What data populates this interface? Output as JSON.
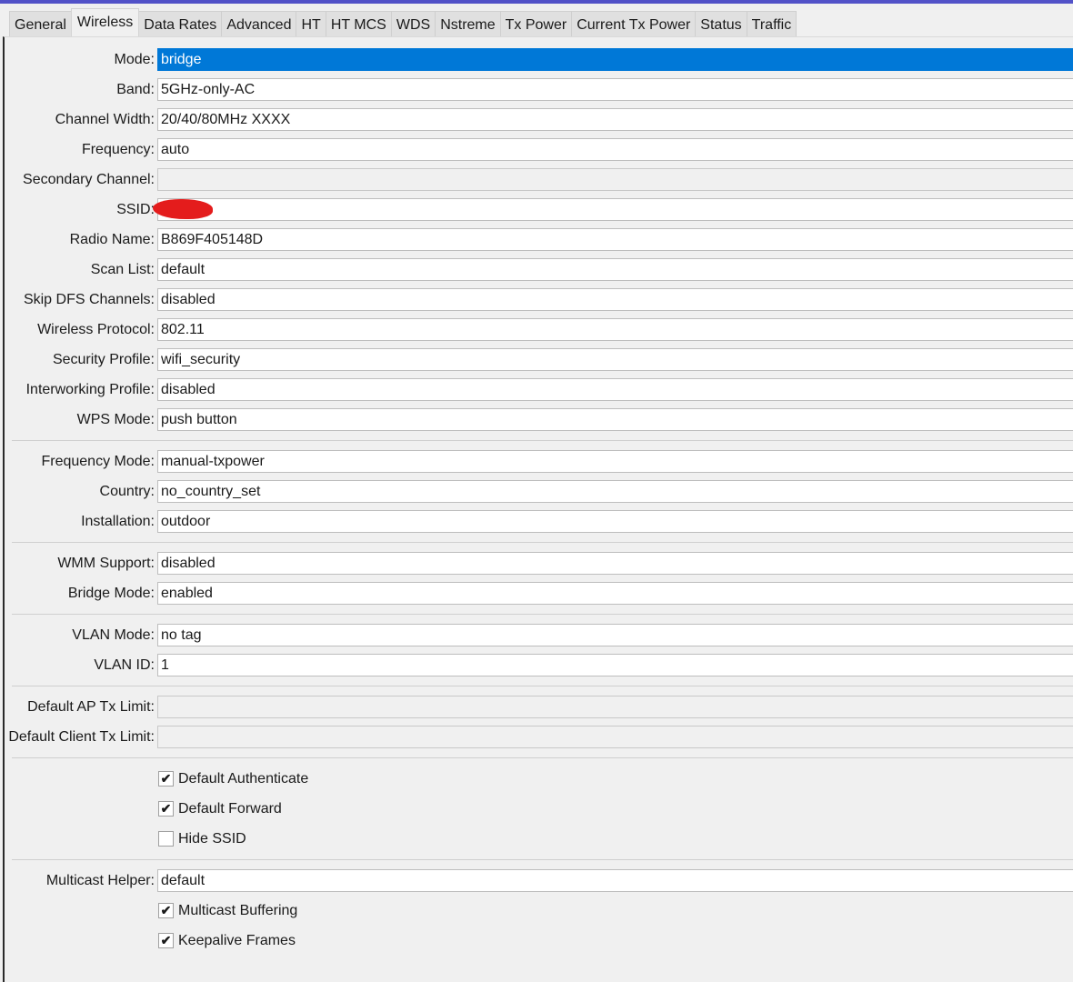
{
  "tabs": [
    "General",
    "Wireless",
    "Data Rates",
    "Advanced",
    "HT",
    "HT MCS",
    "WDS",
    "Nstreme",
    "Tx Power",
    "Current Tx Power",
    "Status",
    "Traffic"
  ],
  "active_tab": 1,
  "form": [
    {
      "type": "field",
      "label": "Mode:",
      "value": "bridge",
      "state": "selected"
    },
    {
      "type": "field",
      "label": "Band:",
      "value": "5GHz-only-AC"
    },
    {
      "type": "field",
      "label": "Channel Width:",
      "value": "20/40/80MHz XXXX"
    },
    {
      "type": "field",
      "label": "Frequency:",
      "value": "auto"
    },
    {
      "type": "field",
      "label": "Secondary Channel:",
      "value": "",
      "state": "disabled"
    },
    {
      "type": "field",
      "label": "SSID:",
      "value": null,
      "redacted": true
    },
    {
      "type": "field",
      "label": "Radio Name:",
      "value": "B869F405148D"
    },
    {
      "type": "field",
      "label": "Scan List:",
      "value": "default"
    },
    {
      "type": "field",
      "label": "Skip DFS Channels:",
      "value": "disabled"
    },
    {
      "type": "field",
      "label": "Wireless Protocol:",
      "value": "802.11"
    },
    {
      "type": "field",
      "label": "Security Profile:",
      "value": "wifi_security"
    },
    {
      "type": "field",
      "label": "Interworking Profile:",
      "value": "disabled"
    },
    {
      "type": "field",
      "label": "WPS Mode:",
      "value": "push button"
    },
    {
      "type": "sep"
    },
    {
      "type": "field",
      "label": "Frequency Mode:",
      "value": "manual-txpower"
    },
    {
      "type": "field",
      "label": "Country:",
      "value": "no_country_set"
    },
    {
      "type": "field",
      "label": "Installation:",
      "value": "outdoor"
    },
    {
      "type": "sep"
    },
    {
      "type": "field",
      "label": "WMM Support:",
      "value": "disabled"
    },
    {
      "type": "field",
      "label": "Bridge Mode:",
      "value": "enabled"
    },
    {
      "type": "sep"
    },
    {
      "type": "field",
      "label": "VLAN Mode:",
      "value": "no tag"
    },
    {
      "type": "field",
      "label": "VLAN ID:",
      "value": "1"
    },
    {
      "type": "sep"
    },
    {
      "type": "field",
      "label": "Default AP Tx Limit:",
      "value": "",
      "state": "disabled"
    },
    {
      "type": "field",
      "label": "Default Client Tx Limit:",
      "value": "",
      "state": "disabled"
    },
    {
      "type": "sep"
    },
    {
      "type": "check",
      "label": "Default Authenticate",
      "checked": true
    },
    {
      "type": "check",
      "label": "Default Forward",
      "checked": true
    },
    {
      "type": "check",
      "label": "Hide SSID",
      "checked": false
    },
    {
      "type": "sep"
    },
    {
      "type": "field",
      "label": "Multicast Helper:",
      "value": "default"
    },
    {
      "type": "check",
      "label": "Multicast Buffering",
      "checked": true
    },
    {
      "type": "check",
      "label": "Keepalive Frames",
      "checked": true
    }
  ]
}
